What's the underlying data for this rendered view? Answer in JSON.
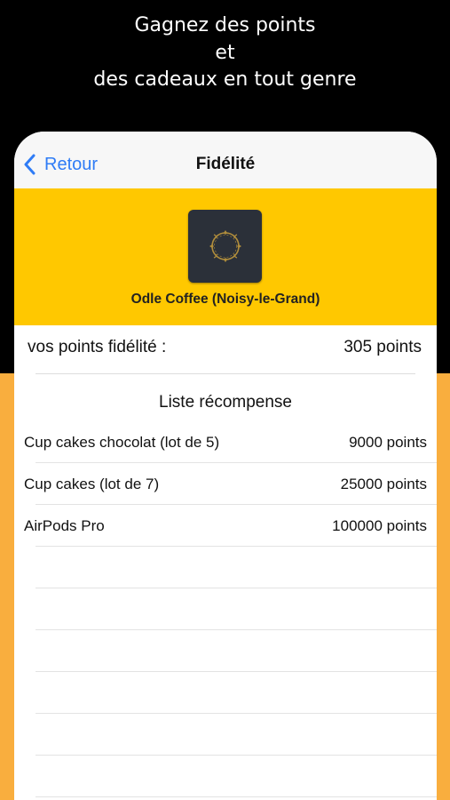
{
  "promo": {
    "line1": "Gagnez des points",
    "line2": "et",
    "line3": "des cadeaux en tout genre"
  },
  "navbar": {
    "back_label": "Retour",
    "title": "Fidélité"
  },
  "shop": {
    "name": "Odle Coffee (Noisy-le-Grand)",
    "logo_icon": "ornate-wreath-logo-icon"
  },
  "points": {
    "label": "vos points fidélité :",
    "value": "305 points"
  },
  "rewards": {
    "title": "Liste récompense",
    "items": [
      {
        "name": "Cup cakes chocolat (lot de 5)",
        "points": "9000 points"
      },
      {
        "name": "Cup cakes (lot de 7)",
        "points": "25000 points"
      },
      {
        "name": "AirPods Pro",
        "points": "100000 points"
      }
    ]
  },
  "colors": {
    "background_top": "#000000",
    "background_bottom": "#F9AE3E",
    "header_yellow": "#FFC800",
    "link_blue": "#2F7CF6",
    "logo_bg": "#2B3039",
    "logo_gold": "#B08D3C"
  }
}
